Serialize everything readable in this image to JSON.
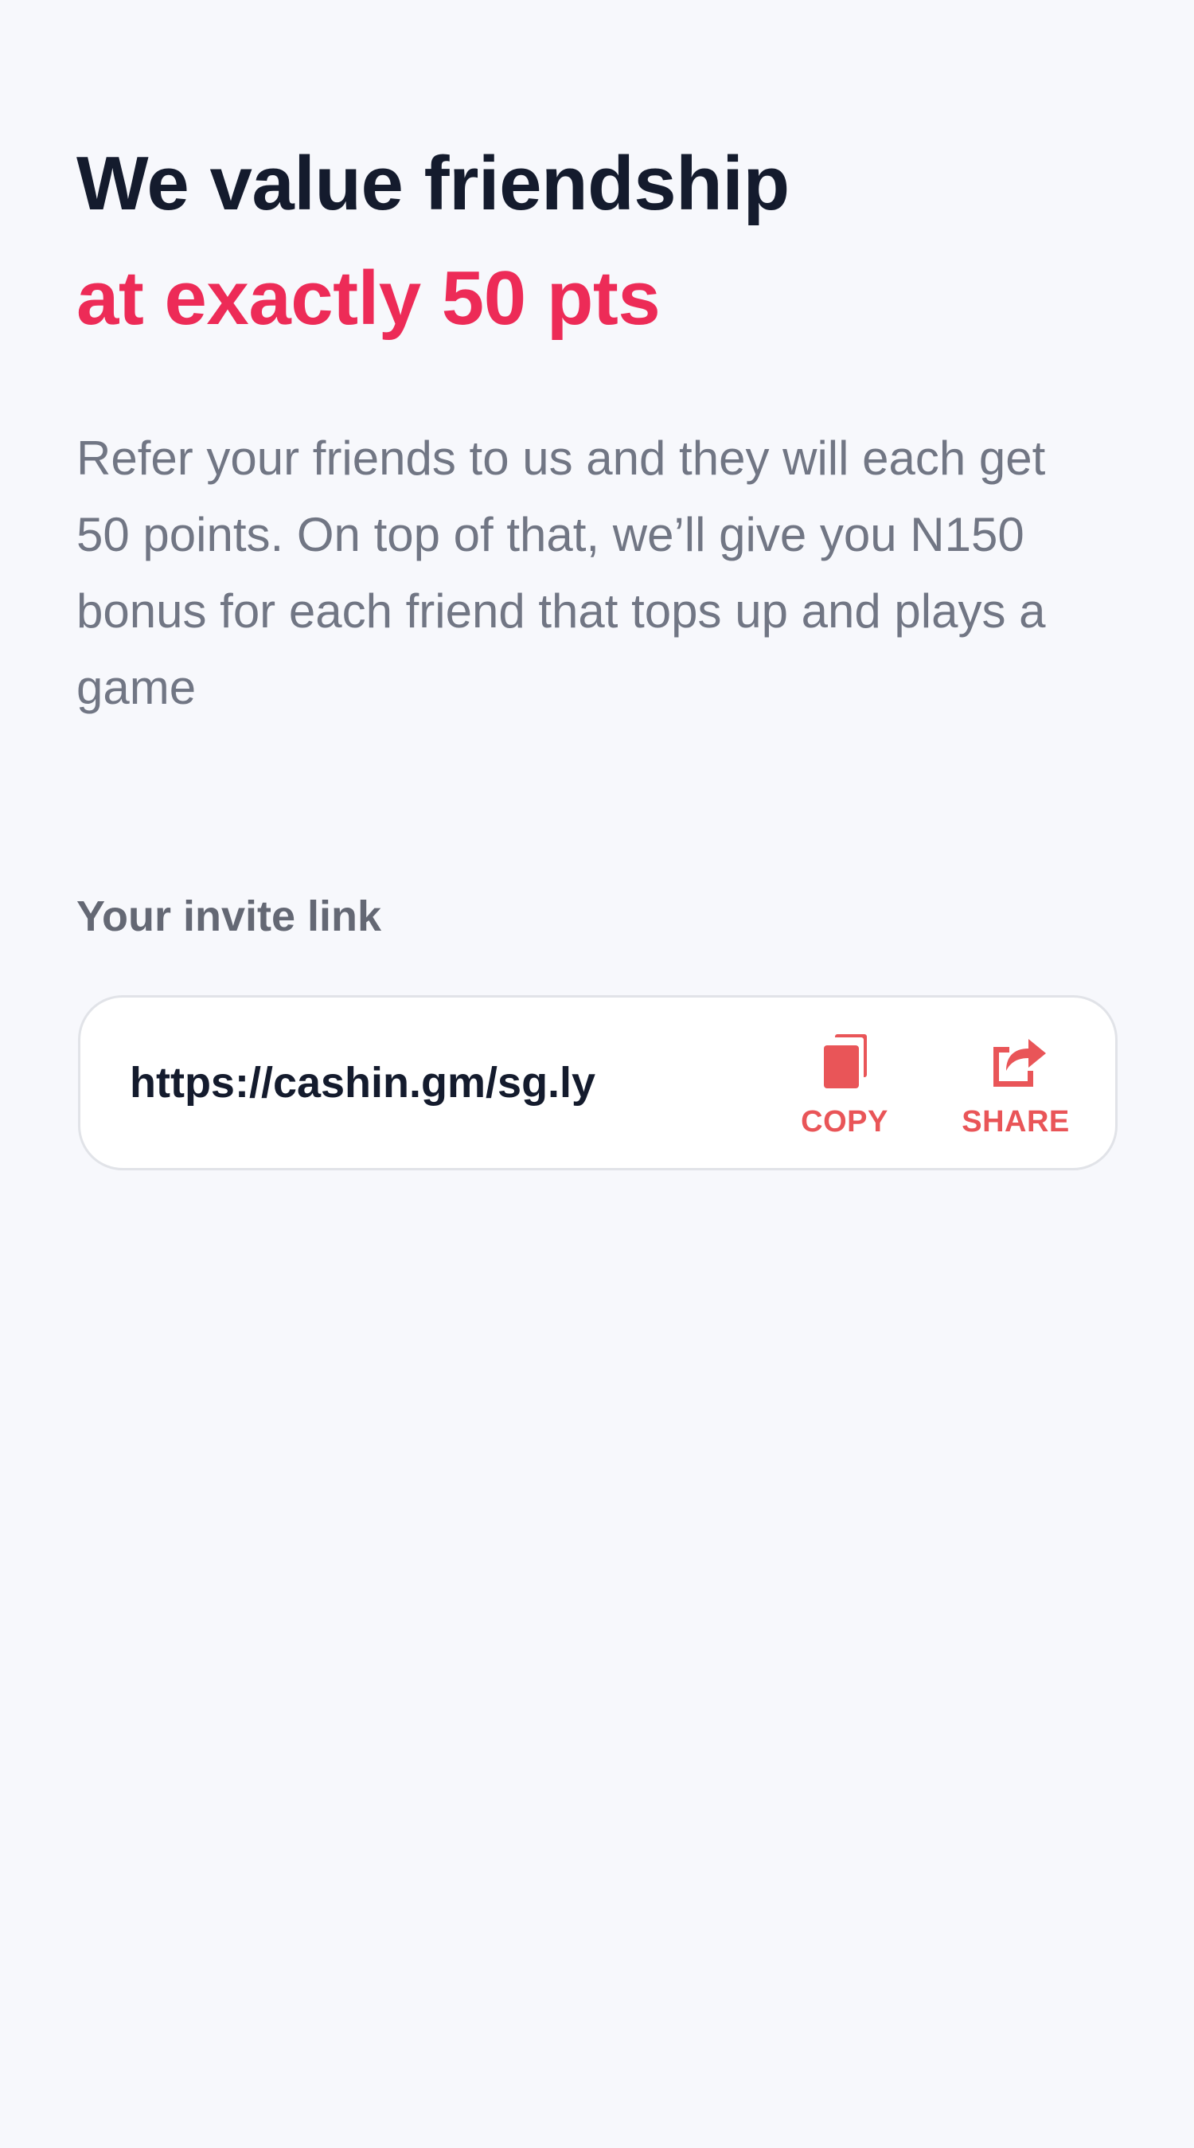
{
  "hero": {
    "title": "We value friendship",
    "title_accent": "at exactly 50 pts",
    "description": "Refer your friends to us and they will each get 50 points. On top of that, we’ll give you N150 bonus for each friend that tops up and plays a game"
  },
  "invite": {
    "label": "Your invite link",
    "link": "https://cashin.gm/sg.ly",
    "copy_label": "COPY",
    "copy_icon": "copy-icon",
    "share_label": "SHARE",
    "share_icon": "share-icon"
  },
  "colors": {
    "background": "#f7f8fc",
    "title": "#141b2d",
    "accent": "#ed2b57",
    "action": "#e95558",
    "body_text": "#717684"
  }
}
